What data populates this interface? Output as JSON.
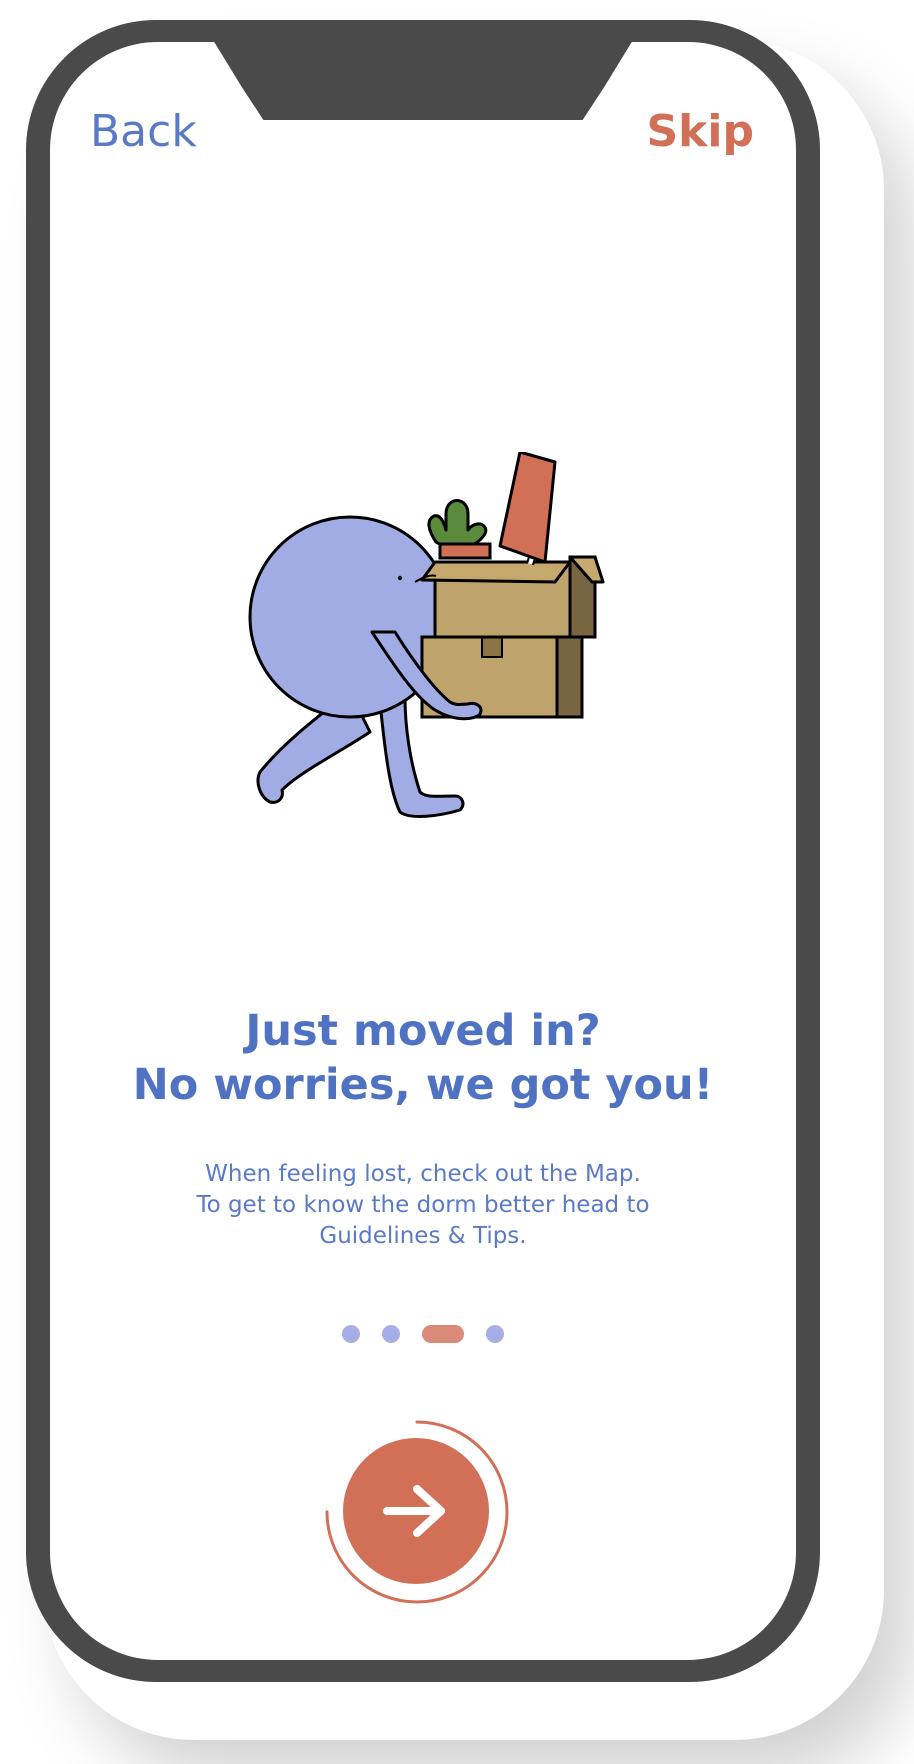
{
  "nav": {
    "back_label": "Back",
    "skip_label": "Skip"
  },
  "headline": {
    "line1": "Just moved in?",
    "line2": "No worries, we got you!"
  },
  "description": {
    "line1": "When feeling lost, check out the Map.",
    "line2": "To get to know the dorm better head to",
    "line3": "Guidelines & Tips."
  },
  "pager": {
    "total": 4,
    "current": 3
  },
  "next_button": {
    "icon": "arrow-right-icon",
    "progress": 0.75
  },
  "colors": {
    "primary_blue": "#5b7ac6",
    "accent_coral": "#d26f57",
    "dot_inactive": "#a5aee6",
    "dot_active": "#d98a78"
  },
  "illustration": {
    "subject": "character-carrying-moving-boxes"
  }
}
